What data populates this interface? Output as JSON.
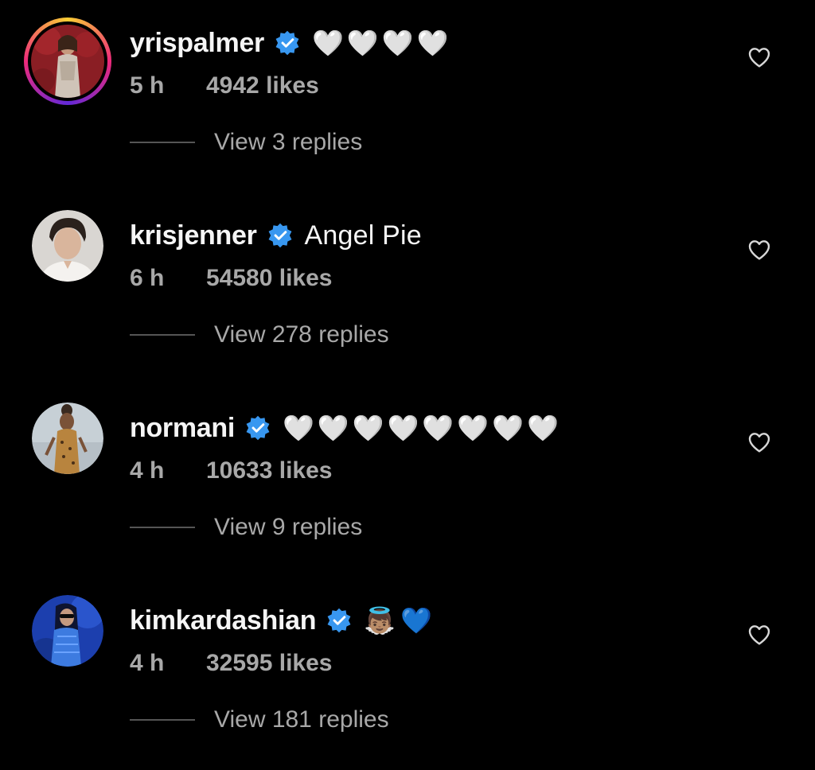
{
  "comments": [
    {
      "username": "yrispalmer",
      "verified": true,
      "text": "🤍🤍🤍🤍",
      "time": "5 h",
      "likes": "4942 likes",
      "replies": "View 3 replies",
      "has_story_ring": true
    },
    {
      "username": "krisjenner",
      "verified": true,
      "text": "Angel Pie",
      "time": "6 h",
      "likes": "54580 likes",
      "replies": "View 278 replies",
      "has_story_ring": false
    },
    {
      "username": "normani",
      "verified": true,
      "text": "🤍🤍🤍🤍🤍🤍🤍🤍",
      "time": "4 h",
      "likes": "10633 likes",
      "replies": "View 9 replies",
      "has_story_ring": false
    },
    {
      "username": "kimkardashian",
      "verified": true,
      "text": "👼🏽💙",
      "time": "4 h",
      "likes": "32595 likes",
      "replies": "View 181 replies",
      "has_story_ring": false
    }
  ],
  "colors": {
    "background": "#000000",
    "primary_text": "#f5f5f5",
    "secondary_text": "#a8a8a8",
    "verified_badge": "#3897f0",
    "story_ring": [
      "#f9ce34",
      "#ee2a7b",
      "#6228d7"
    ]
  },
  "icons": {
    "verified": "verified-badge-icon",
    "like": "heart-outline-icon"
  }
}
